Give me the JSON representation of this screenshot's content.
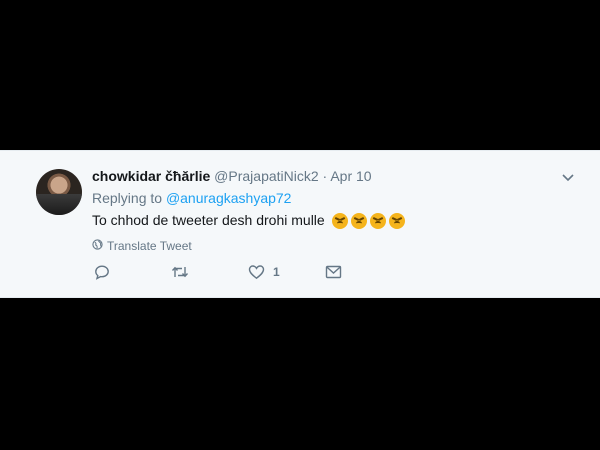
{
  "tweet": {
    "display_name": "chowkidar čħărlie",
    "handle": "@PrajapatiNick2",
    "separator": "·",
    "date": "Apr 10",
    "replying_prefix": "Replying to",
    "replying_to": "@anuragkashyap72",
    "text": "To chhod de tweeter desh drohi mulle",
    "emojis": [
      "angry-face",
      "angry-face",
      "angry-face",
      "angry-face"
    ],
    "translate_label": "Translate Tweet",
    "actions": {
      "reply_count": "",
      "retweet_count": "",
      "like_count": "1",
      "dm_count": ""
    }
  },
  "colors": {
    "background": "#000000",
    "card": "#f5f8fa",
    "link": "#1da1f2",
    "secondary_text": "#657786",
    "primary_text": "#14171a"
  }
}
